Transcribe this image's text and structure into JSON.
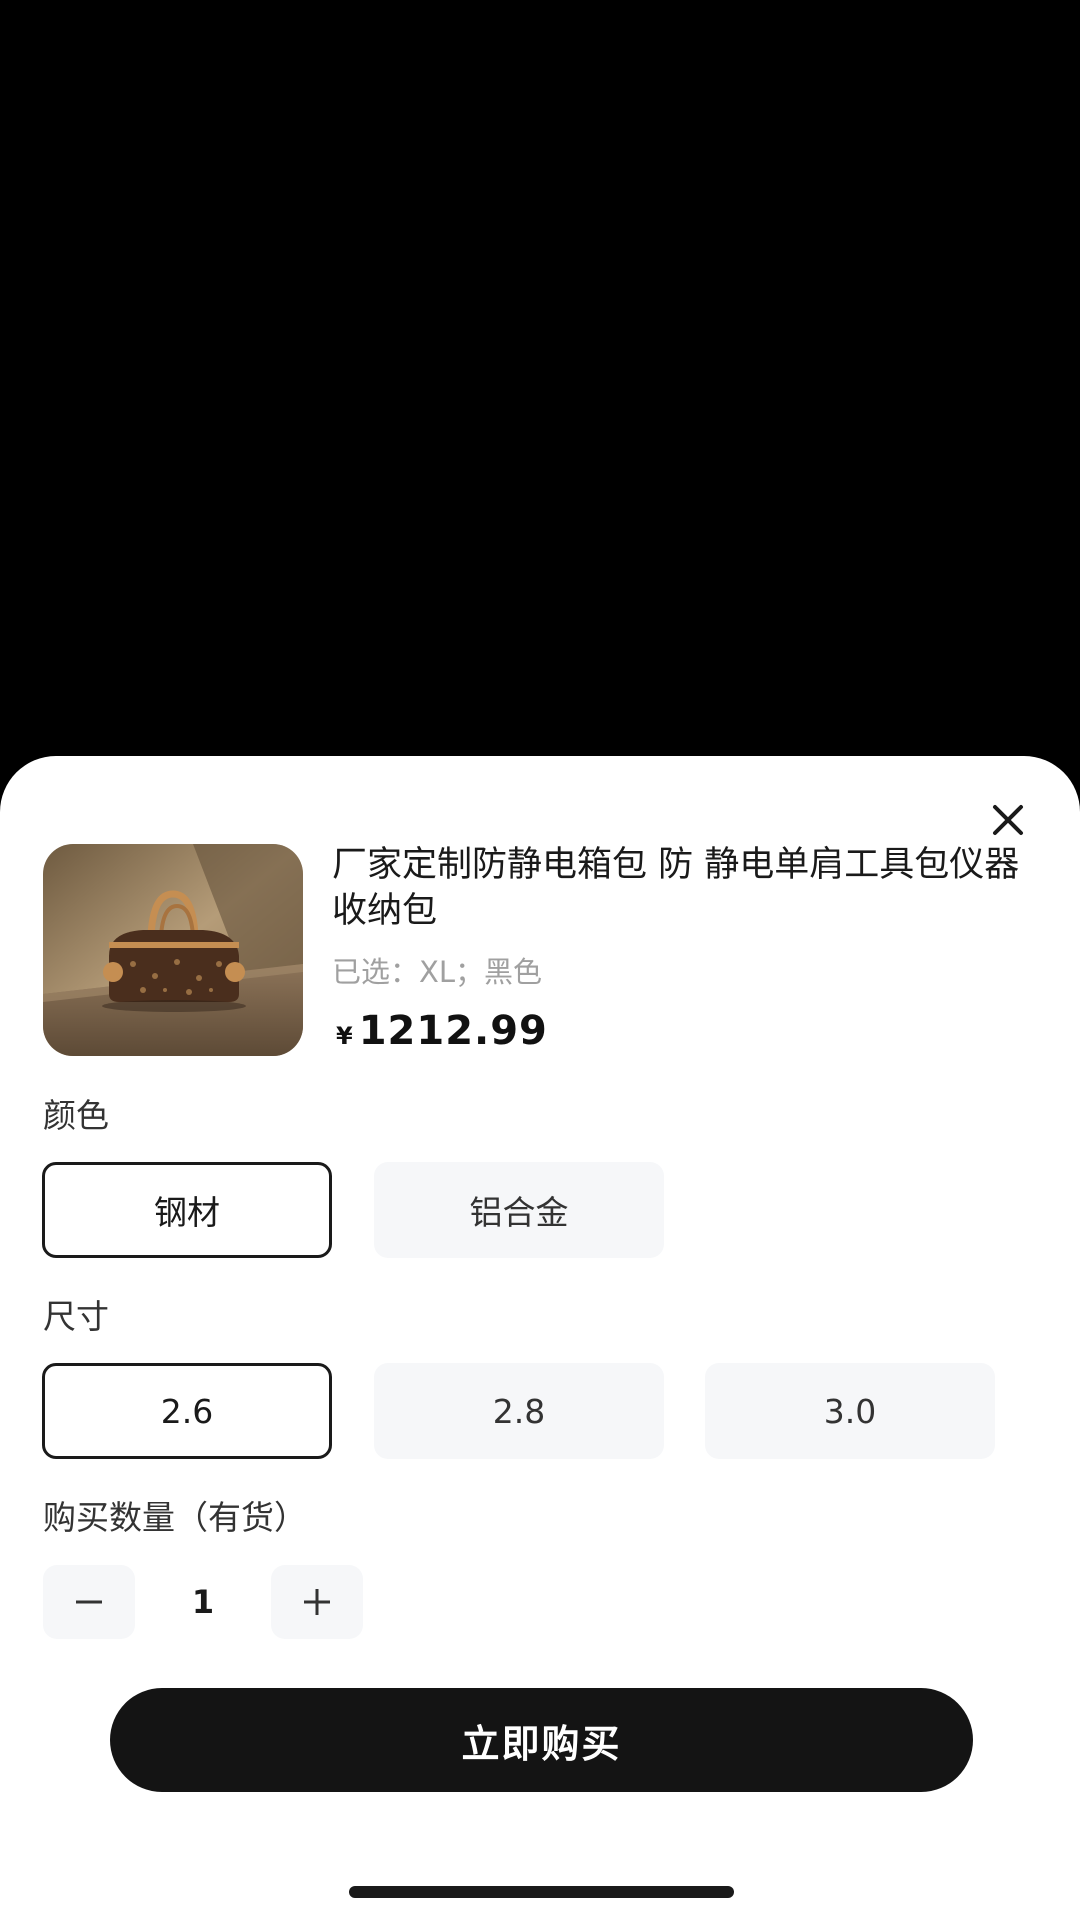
{
  "product": {
    "title": "厂家定制防静电箱包 防 静电单肩工具包仪器收纳包",
    "selected": "已选：XL；黑色",
    "currency_symbol": "¥",
    "price": "1212.99",
    "image_icon": "handbag-product-photo"
  },
  "color_section": {
    "label": "颜色",
    "options": [
      {
        "label": "钢材",
        "selected": true
      },
      {
        "label": "铝合金",
        "selected": false
      }
    ]
  },
  "size_section": {
    "label": "尺寸",
    "options": [
      {
        "label": "2.6",
        "selected": true
      },
      {
        "label": "2.8",
        "selected": false
      },
      {
        "label": "3.0",
        "selected": false
      }
    ]
  },
  "quantity": {
    "label": "购买数量（有货）",
    "value": "1",
    "decrement_icon": "minus-icon",
    "increment_icon": "plus-icon"
  },
  "actions": {
    "buy_now": "立即购买",
    "close_icon": "close-icon"
  },
  "colors": {
    "primary": "#141414",
    "option_bg": "#f6f7f9",
    "muted_text": "#a0a0a0"
  }
}
